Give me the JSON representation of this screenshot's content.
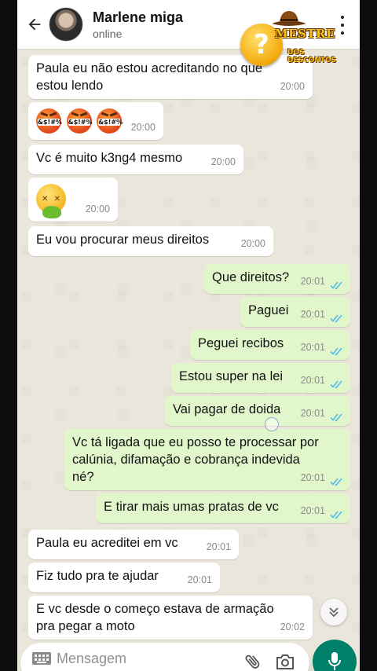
{
  "header": {
    "contact_name": "Marlene miga",
    "status": "online"
  },
  "watermark": {
    "title": "MESTRE",
    "subtitle": "DOS DESCONTOS",
    "symbol": "?"
  },
  "colors": {
    "incoming_bubble": "#ffffff",
    "outgoing_bubble": "#e1f7cb",
    "chat_background": "#ebe6dc",
    "read_ticks": "#53bdeb",
    "accent": "#008069"
  },
  "messages": [
    {
      "direction": "in",
      "text": "Paula eu não estou acreditando no que\nestou lendo",
      "time": "20:00"
    },
    {
      "direction": "in",
      "emoji": [
        "face-with-symbols-on-mouth",
        "face-with-symbols-on-mouth",
        "face-with-symbols-on-mouth"
      ],
      "emoji_text": "&$!#%",
      "time": "20:00"
    },
    {
      "direction": "in",
      "text": "Vc é muito k3ng4 mesmo",
      "time": "20:00"
    },
    {
      "direction": "in",
      "emoji": [
        "face-vomiting"
      ],
      "time": "20:00"
    },
    {
      "direction": "in",
      "text": "Eu vou procurar meus direitos",
      "time": "20:00"
    },
    {
      "direction": "out",
      "text": "Que direitos?",
      "time": "20:01",
      "status": "read"
    },
    {
      "direction": "out",
      "text": "Paguei",
      "time": "20:01",
      "status": "read"
    },
    {
      "direction": "out",
      "text": "Peguei recibos",
      "time": "20:01",
      "status": "read"
    },
    {
      "direction": "out",
      "text": "Estou super na lei",
      "time": "20:01",
      "status": "read"
    },
    {
      "direction": "out",
      "text": "Vai pagar de doida",
      "time": "20:01",
      "status": "read"
    },
    {
      "direction": "out",
      "text": "Vc tá ligada que eu posso te processar por\ncalúnia, difamação e cobrança indevida\nné?",
      "time": "20:01",
      "status": "read"
    },
    {
      "direction": "out",
      "text": "E tirar mais umas pratas de vc",
      "time": "20:01",
      "status": "read"
    },
    {
      "direction": "in",
      "text": "Paula eu acreditei em vc",
      "time": "20:01"
    },
    {
      "direction": "in",
      "text": "Fiz tudo pra te ajudar",
      "time": "20:01"
    },
    {
      "direction": "in",
      "text": "E vc desde o começo estava de armação\npra pegar a moto",
      "time": "20:02"
    }
  ],
  "composer": {
    "placeholder": "Mensagem"
  },
  "icons": [
    "back-arrow-icon",
    "more-vert-icon",
    "keyboard-icon",
    "paperclip-icon",
    "camera-icon",
    "mic-icon",
    "chevron-double-down-icon",
    "double-check-icon"
  ]
}
